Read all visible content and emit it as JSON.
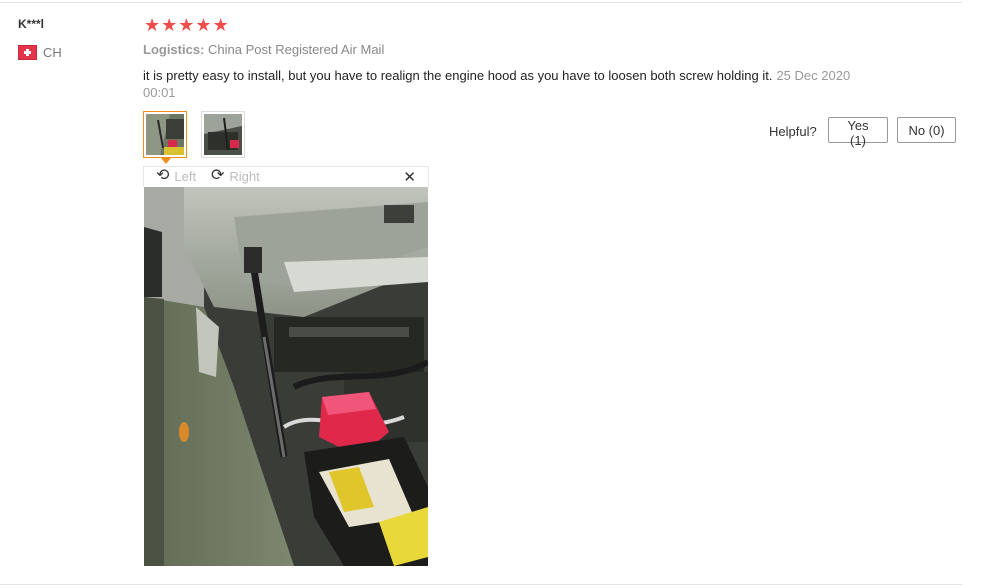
{
  "review": {
    "user_name": "K***l",
    "country_code": "CH",
    "rating": 5,
    "star_glyph": "★",
    "star_color": "#f04c4c",
    "logistics_label": "Logistics:",
    "logistics_value": "China Post Registered Air Mail",
    "text": "it is pretty easy to install, but you have to realign the engine hood as you have to loosen both screw holding it.",
    "date": "25 Dec 2020 00:01"
  },
  "viewer": {
    "rotate_left_label": "Left",
    "rotate_right_label": "Right",
    "rotate_left_glyph": "⟲",
    "rotate_right_glyph": "⟳",
    "close_glyph": "✕"
  },
  "feedback": {
    "helpful_label": "Helpful?",
    "yes_label": "Yes (1)",
    "no_label": "No (0)"
  },
  "icons": {
    "flag": "swiss-flag-icon",
    "star": "star-icon",
    "rotate_left": "rotate-left-icon",
    "rotate_right": "rotate-right-icon",
    "close": "close-icon"
  },
  "colors": {
    "accent_orange": "#f08e1a",
    "star_red": "#f04c4c",
    "muted_text": "#999999"
  }
}
